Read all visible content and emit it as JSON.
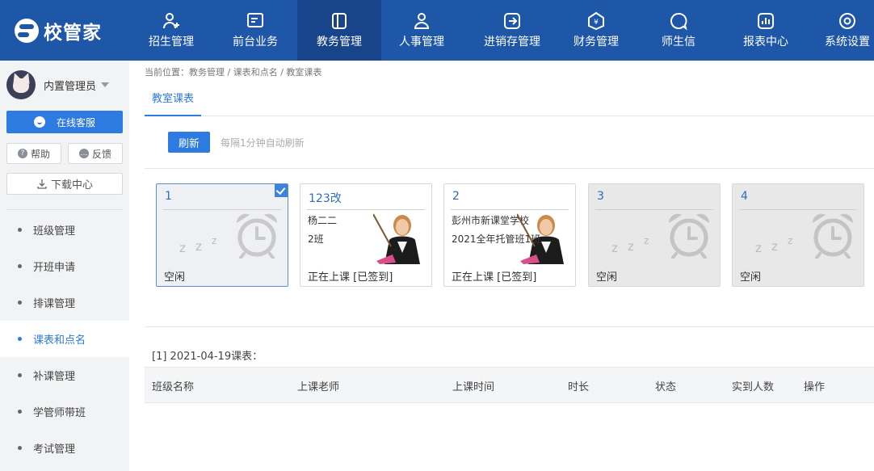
{
  "app": {
    "logo_text": "校管家"
  },
  "nav": [
    {
      "label": "招生管理",
      "icon": "user-add-icon"
    },
    {
      "label": "前台业务",
      "icon": "desk-icon"
    },
    {
      "label": "教务管理",
      "icon": "book-icon",
      "active": true
    },
    {
      "label": "人事管理",
      "icon": "person-icon"
    },
    {
      "label": "进销存管理",
      "icon": "inventory-icon"
    },
    {
      "label": "财务管理",
      "icon": "money-icon"
    },
    {
      "label": "师生信",
      "icon": "chat-icon"
    },
    {
      "label": "报表中心",
      "icon": "report-icon"
    },
    {
      "label": "系统设置",
      "icon": "settings-icon"
    }
  ],
  "sidebar": {
    "user_name": "内置管理员",
    "service_label": "在线客服",
    "help_label": "帮助",
    "feedback_label": "反馈",
    "download_label": "下载中心",
    "items": [
      {
        "label": "班级管理"
      },
      {
        "label": "开班申请"
      },
      {
        "label": "排课管理"
      },
      {
        "label": "课表和点名",
        "active": true
      },
      {
        "label": "补课管理"
      },
      {
        "label": "学管师带班"
      },
      {
        "label": "考试管理"
      }
    ]
  },
  "breadcrumb": "当前位置：教务管理 / 课表和点名 / 教室课表",
  "tab_label": "教室课表",
  "toolbar": {
    "refresh_label": "刷新",
    "auto_note": "每隔1分钟自动刷新"
  },
  "rooms": [
    {
      "name": "1",
      "status": "空闲",
      "state": "idle",
      "selected": true
    },
    {
      "name": "123改",
      "status": "正在上课 [已签到]",
      "state": "busy",
      "line1": "杨二二",
      "line2": "2班"
    },
    {
      "name": "2",
      "status": "正在上课 [已签到]",
      "state": "busy",
      "line1": "彭州市新课堂学校",
      "line2": "2021全年托管班1班"
    },
    {
      "name": "3",
      "status": "空闲",
      "state": "idle"
    },
    {
      "name": "4",
      "status": "空闲",
      "state": "idle"
    }
  ],
  "schedule": {
    "date_title": "[1] 2021-04-19课表：",
    "columns": [
      "班级名称",
      "上课老师",
      "上课时间",
      "时长",
      "状态",
      "实到人数",
      "操作"
    ]
  },
  "colors": {
    "primary": "#1e56a8",
    "accent": "#2d7ae0"
  }
}
